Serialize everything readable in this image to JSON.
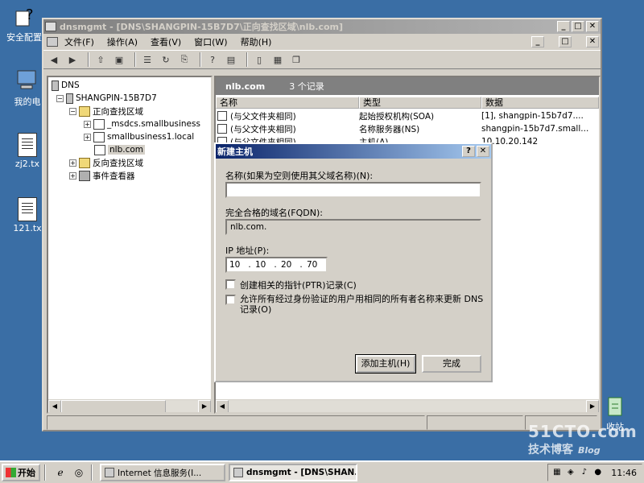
{
  "desktop": {
    "icons": [
      {
        "label": "安全配置"
      },
      {
        "label": "我的电"
      },
      {
        "label": "zj2.tx"
      },
      {
        "label": "121.tx"
      },
      {
        "label": "收站"
      }
    ]
  },
  "window": {
    "title": "dnsmgmt - [DNS\\SHANGPIN-15B7D7\\正向查找区域\\nlb.com]",
    "menu": [
      "文件(F)",
      "操作(A)",
      "查看(V)",
      "窗口(W)",
      "帮助(H)"
    ]
  },
  "tree": {
    "root": "DNS",
    "server": "SHANGPIN-15B7D7",
    "forward_zones": "正向查找区域",
    "zones": [
      "_msdcs.smallbusiness",
      "smallbusiness1.local",
      "nlb.com"
    ],
    "reverse_zones": "反向查找区域",
    "event_viewer": "事件查看器"
  },
  "records_panel": {
    "zone_name": "nlb.com",
    "count_text": "3 个记录",
    "columns": [
      "名称",
      "类型",
      "数据"
    ],
    "rows": [
      {
        "name": "(与父文件夹相同)",
        "type": "起始授权机构(SOA)",
        "data": "[1], shangpin-15b7d7...."
      },
      {
        "name": "(与父文件夹相同)",
        "type": "名称服务器(NS)",
        "data": "shangpin-15b7d7.small..."
      },
      {
        "name": "(与父文件夹相同)",
        "type": "主机(A)",
        "data": "10.10.20.142"
      }
    ]
  },
  "dialog": {
    "title": "新建主机",
    "name_label": "名称(如果为空则使用其父域名称)(N):",
    "name_value": "",
    "fqdn_label": "完全合格的域名(FQDN):",
    "fqdn_value": "nlb.com.",
    "ip_label": "IP 地址(P):",
    "ip_octets": [
      "10",
      "10",
      "20",
      "70"
    ],
    "ptr_label": "创建相关的指针(PTR)记录(C)",
    "auth_label": "允许所有经过身份验证的用户用相同的所有者名称来更新 DNS 记录(O)",
    "add_button": "添加主机(H)",
    "done_button": "完成"
  },
  "taskbar": {
    "start": "开始",
    "tasks": [
      "Internet 信息服务(I...",
      "dnsmgmt - [DNS\\SHAN..."
    ],
    "clock": "11:46"
  },
  "watermark": {
    "line1": "51CTO.com",
    "line2": "技术博客",
    "line3": "Blog"
  }
}
